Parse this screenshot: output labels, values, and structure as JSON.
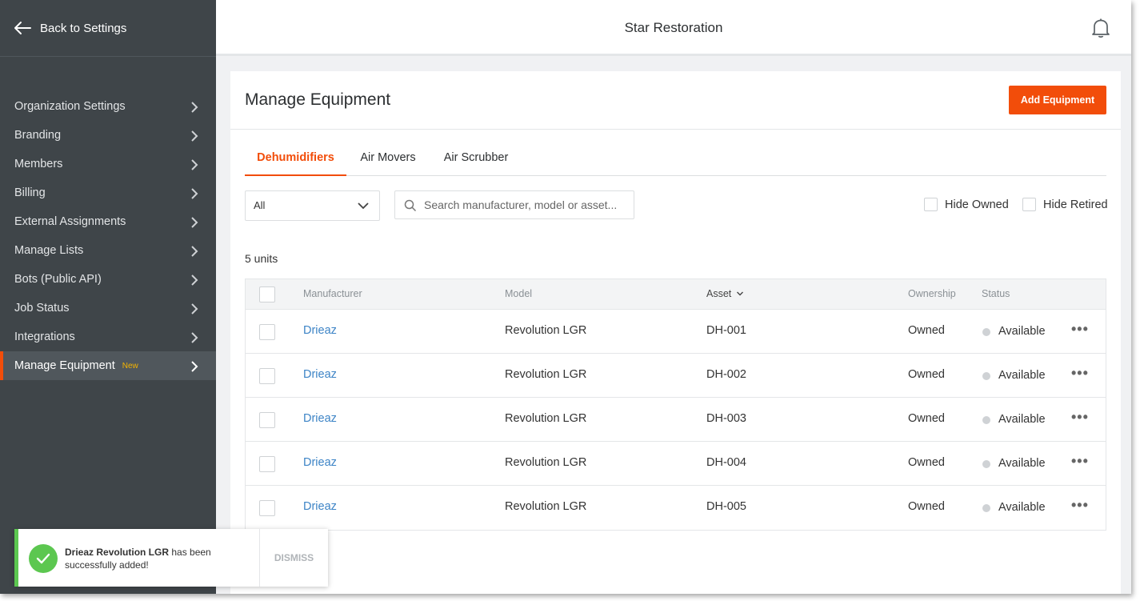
{
  "sidebar": {
    "back_label": "Back to Settings",
    "items": [
      {
        "label": "Organization Settings"
      },
      {
        "label": "Branding"
      },
      {
        "label": "Members"
      },
      {
        "label": "Billing"
      },
      {
        "label": "External Assignments"
      },
      {
        "label": "Manage Lists"
      },
      {
        "label": "Bots (Public API)"
      },
      {
        "label": "Job Status"
      },
      {
        "label": "Integrations"
      },
      {
        "label": "Manage Equipment",
        "badge": "New",
        "active": true
      }
    ]
  },
  "header": {
    "title": "Star Restoration",
    "bell_icon": "bell-icon"
  },
  "main": {
    "title": "Manage Equipment",
    "add_button": "Add Equipment",
    "tabs": [
      {
        "label": "Dehumidifiers",
        "active": true
      },
      {
        "label": "Air Movers"
      },
      {
        "label": "Air Scrubber"
      }
    ],
    "filter_select": {
      "value": "All"
    },
    "search": {
      "placeholder": "Search manufacturer, model or asset...",
      "value": ""
    },
    "hide_owned_label": "Hide Owned",
    "hide_retired_label": "Hide Retired",
    "units_count": "5 units",
    "table": {
      "headers": {
        "manufacturer": "Manufacturer",
        "model": "Model",
        "asset": "Asset",
        "ownership": "Ownership",
        "status": "Status"
      },
      "rows": [
        {
          "manufacturer": "Drieaz",
          "model": "Revolution LGR",
          "asset": "DH-001",
          "ownership": "Owned",
          "status": "Available"
        },
        {
          "manufacturer": "Drieaz",
          "model": "Revolution LGR",
          "asset": "DH-002",
          "ownership": "Owned",
          "status": "Available"
        },
        {
          "manufacturer": "Drieaz",
          "model": "Revolution LGR",
          "asset": "DH-003",
          "ownership": "Owned",
          "status": "Available"
        },
        {
          "manufacturer": "Drieaz",
          "model": "Revolution LGR",
          "asset": "DH-004",
          "ownership": "Owned",
          "status": "Available"
        },
        {
          "manufacturer": "Drieaz",
          "model": "Revolution LGR",
          "asset": "DH-005",
          "ownership": "Owned",
          "status": "Available"
        }
      ]
    }
  },
  "toast": {
    "bold_text": "Drieaz Revolution LGR",
    "text": " has been successfully added!",
    "dismiss": "DISMISS"
  },
  "colors": {
    "accent": "#f24d0a",
    "sidebar_bg": "#3f4549",
    "link": "#3d84c6",
    "success": "#5cc750",
    "new_badge": "#f5b400"
  }
}
